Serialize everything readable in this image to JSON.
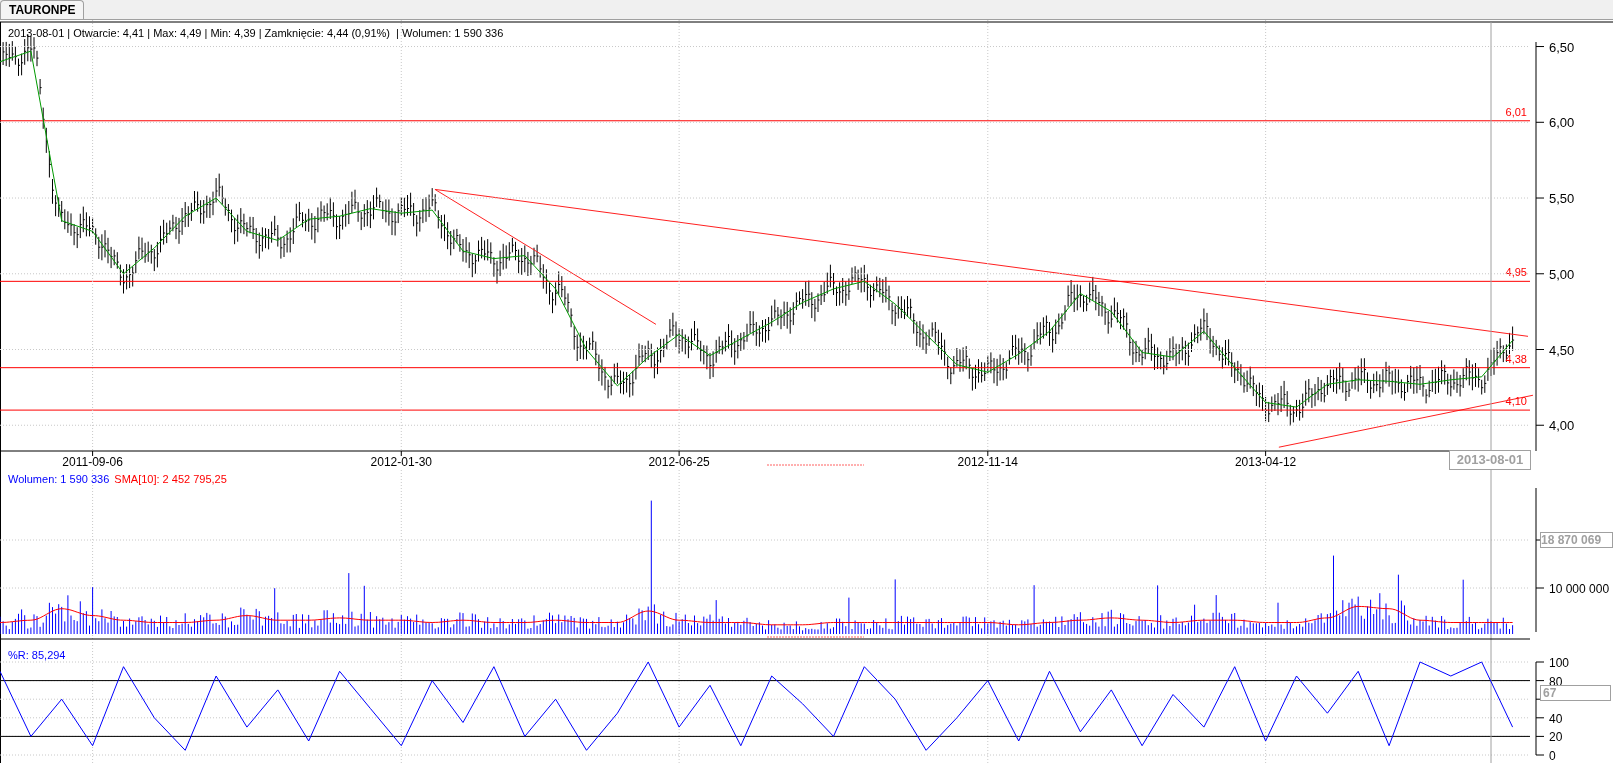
{
  "tabs": [
    {
      "label": "TAURONPE",
      "selected": true
    }
  ],
  "price_panel": {
    "info": "2013-08-01 | Otwarcie: 4,41 | Max: 4,49 | Min: 4,39 | Zamknięcie: 4,44 (0,91%)  | Wolumen: 1 590 336",
    "cursor_label": "2013-08-01",
    "level_labels": [
      "6,01",
      "4,95",
      "4,38",
      "4,10"
    ],
    "chart_data": {
      "type": "line",
      "grid": true,
      "categories": [
        null,
        null,
        null,
        "2011-09-06",
        null,
        null,
        null,
        null,
        null,
        null,
        null,
        null,
        null,
        "2012-01-30",
        null,
        null,
        null,
        null,
        null,
        null,
        null,
        null,
        "2012-06-25",
        null,
        null,
        null,
        null,
        null,
        null,
        null,
        null,
        null,
        "2012-11-14",
        null,
        null,
        null,
        null,
        null,
        null,
        null,
        null,
        "2013-04-12",
        null,
        null,
        null,
        null,
        null,
        null,
        null,
        null
      ],
      "ylim": [
        3.83,
        6.53
      ],
      "yticks": [
        {
          "value": 4,
          "label": "4,00"
        },
        {
          "value": 4.5,
          "label": "4,50"
        },
        {
          "value": 5,
          "label": "5,00"
        },
        {
          "value": 5.5,
          "label": "5,50"
        },
        {
          "value": 6,
          "label": "6,00"
        },
        {
          "value": 6.5,
          "label": "6,50"
        }
      ],
      "series": [
        {
          "color": "#009900",
          "values": [
            6.4,
            6.47,
            5.35,
            5.28,
            5.0,
            5.17,
            5.38,
            5.5,
            5.28,
            5.22,
            5.36,
            5.38,
            5.43,
            5.4,
            5.42,
            5.15,
            5.1,
            5.12,
            4.9,
            4.5,
            4.26,
            4.45,
            4.6,
            4.46,
            4.57,
            4.68,
            4.81,
            4.9,
            4.95,
            4.8,
            4.6,
            4.4,
            4.35,
            4.47,
            4.62,
            4.87,
            4.75,
            4.48,
            4.45,
            4.62,
            4.38,
            4.15,
            4.12,
            4.27,
            4.3,
            4.29,
            4.27,
            4.3,
            4.32,
            4.56
          ]
        }
      ]
    }
  },
  "volume_panel": {
    "legend": [
      {
        "text": "Wolumen: 1 590 336",
        "color": "#0000ff"
      },
      {
        "text": "SMA[10]: 2 452 795,25",
        "color": "#ff0000"
      }
    ],
    "axis_label": "10 000 000",
    "cursor_label": "18 870 069"
  },
  "wr_panel": {
    "legend": "%R: 85,294",
    "cursor_label": "67",
    "chart_data": {
      "type": "line",
      "grid": true,
      "ylim": [
        0,
        100
      ],
      "yticks": [
        {
          "value": 0,
          "label": "0"
        },
        {
          "value": 20,
          "label": "20"
        },
        {
          "value": 40,
          "label": "40"
        },
        {
          "value": 80,
          "label": "80"
        },
        {
          "value": 100,
          "label": "100"
        }
      ],
      "series": [
        {
          "color": "#0000ff",
          "values": [
            90,
            20,
            60,
            10,
            95,
            40,
            5,
            85,
            30,
            70,
            15,
            90,
            50,
            10,
            80,
            35,
            95,
            20,
            60,
            5,
            45,
            100,
            30,
            75,
            10,
            85,
            55,
            20,
            95,
            60,
            5,
            40,
            80,
            15,
            90,
            25,
            70,
            10,
            65,
            30,
            95,
            15,
            85,
            45,
            90,
            10,
            100,
            85,
            100,
            30
          ]
        }
      ]
    }
  }
}
